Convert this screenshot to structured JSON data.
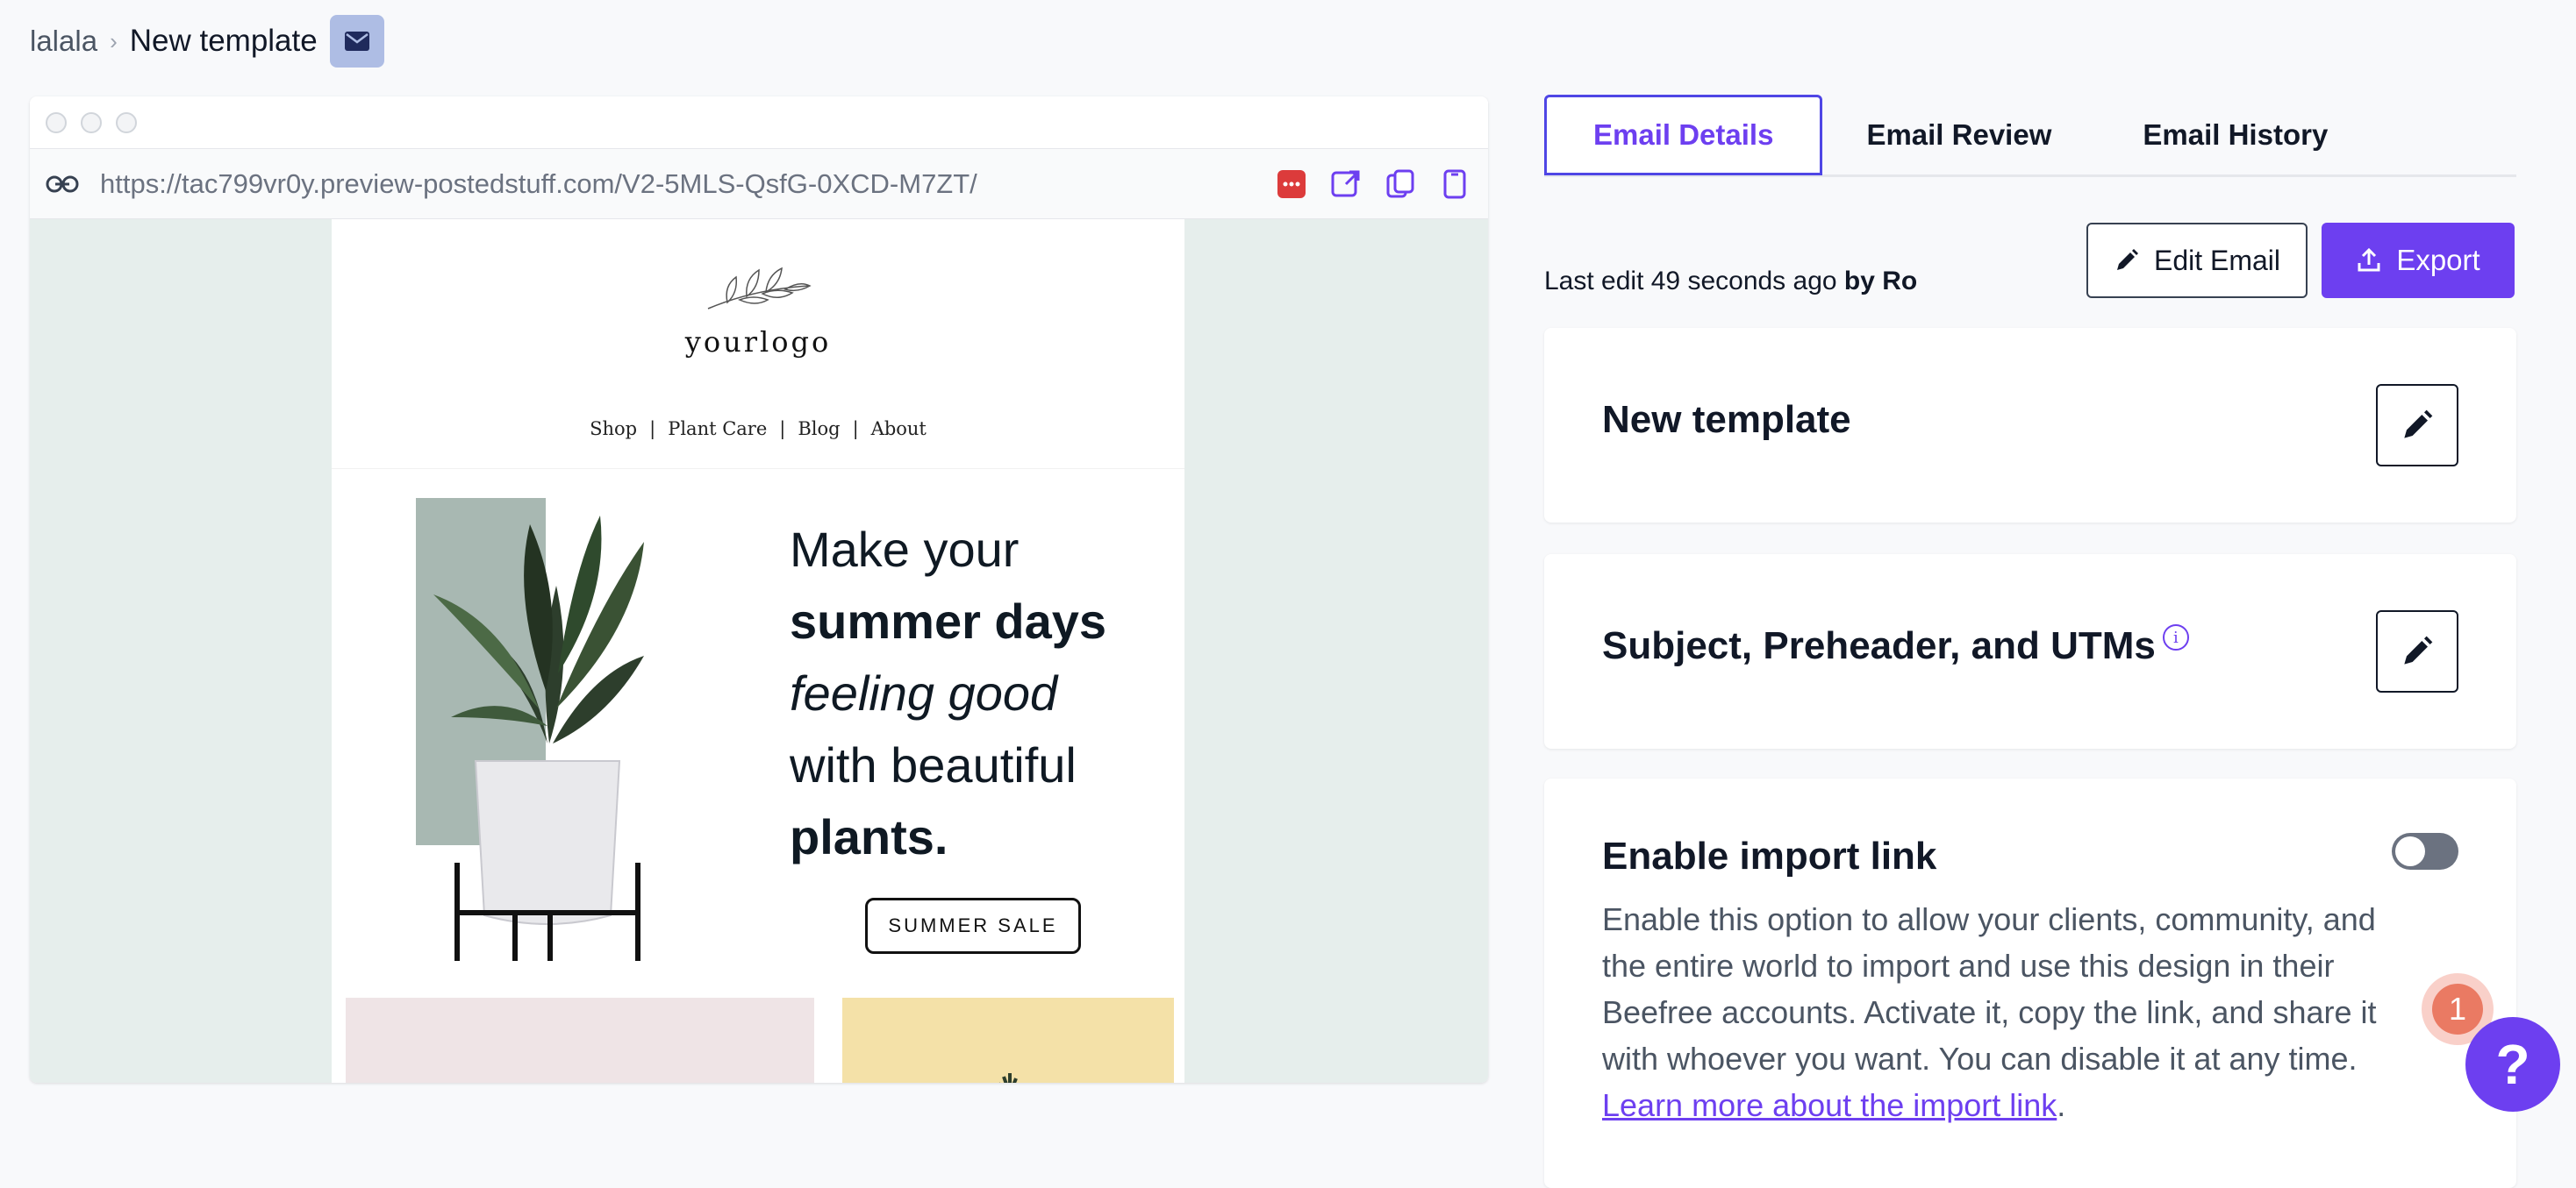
{
  "breadcrumb": {
    "parent": "lalala",
    "separator": "›",
    "current": "New template"
  },
  "preview": {
    "url": "https://tac799vr0y.preview-postedstuff.com/V2-5MLS-QsfG-0XCD-M7ZT/",
    "email": {
      "logo": "yourlogo",
      "nav": [
        "Shop",
        "Plant Care",
        "Blog",
        "About"
      ],
      "nav_sep": "|",
      "hero": {
        "line1": "Make your",
        "line2": "summer days",
        "line3": "feeling good",
        "line4": "with beautiful",
        "line5": "plants."
      },
      "cta": "SUMMER SALE"
    }
  },
  "tabs": [
    "Email Details",
    "Email Review",
    "Email History"
  ],
  "details": {
    "last_edit_prefix": "Last edit 49 seconds ago",
    "last_edit_by": "by Ro",
    "edit_label": "Edit Email",
    "export_label": "Export"
  },
  "cards": {
    "template_name": "New template",
    "subject": "Subject, Preheader, and UTMs",
    "info": "i",
    "import_title": "Enable import link",
    "import_body": "Enable this option to allow your clients, community, and the entire world to import and use this design in their Beefree accounts. Activate it, copy the link, and share it with whoever you want. You can disable it at any time.",
    "import_link": "Learn more about the import link",
    "import_period": "."
  },
  "help": {
    "notification_count": "1",
    "help_label": "?"
  },
  "colors": {
    "accent": "#6d3ff0",
    "canvas": "#e6eeec",
    "badge": "#aebde4"
  }
}
